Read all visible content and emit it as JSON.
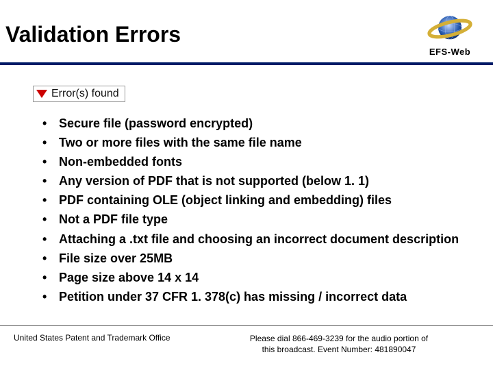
{
  "header": {
    "title": "Validation Errors",
    "logo_text": "EFS-Web"
  },
  "error_badge": "Error(s) found",
  "errors": [
    "Secure file (password encrypted)",
    "Two or more files with the same file name",
    "Non-embedded fonts",
    "Any version of PDF that is not supported (below 1. 1)",
    "PDF containing OLE (object linking and embedding) files",
    "Not a PDF file type",
    "Attaching a .txt file and choosing an incorrect document description",
    "File size over 25MB",
    "Page size above 14 x 14",
    "Petition under 37 CFR 1. 378(c) has missing / incorrect data"
  ],
  "footer": {
    "left": "United States Patent and Trademark Office",
    "right_line1": "Please dial 866-469-3239 for the audio portion of",
    "right_line2": "this broadcast. Event Number: 481890047"
  }
}
